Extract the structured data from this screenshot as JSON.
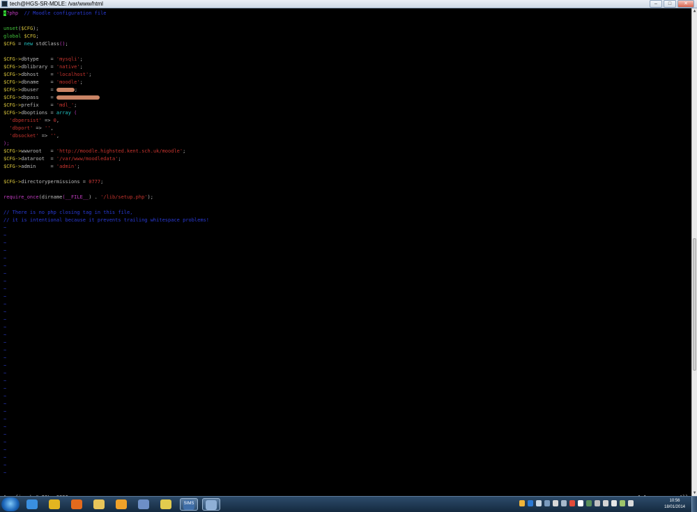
{
  "window": {
    "title": "tech@HGS-SR-MDLE: /var/www/html",
    "controls": {
      "minimize": "–",
      "maximize": "□",
      "close": "✕"
    }
  },
  "editor": {
    "lines": [
      {
        "tokens": [
          {
            "t": "<",
            "c": "tok-cursor"
          },
          {
            "t": "?php",
            "c": "tok-fn"
          },
          {
            "t": "  // Moodle configuration file",
            "c": "tok-cmt"
          }
        ]
      },
      {
        "tokens": []
      },
      {
        "tokens": [
          {
            "t": "unset",
            "c": "tok-green"
          },
          {
            "t": "(",
            "c": "tok-op"
          },
          {
            "t": "$CFG",
            "c": "tok-var"
          },
          {
            "t": ");",
            "c": "tok-op"
          }
        ]
      },
      {
        "tokens": [
          {
            "t": "global",
            "c": "tok-green"
          },
          {
            "t": " $CFG",
            "c": "tok-var"
          },
          {
            "t": ";",
            "c": "tok-op"
          }
        ]
      },
      {
        "tokens": [
          {
            "t": "$CFG",
            "c": "tok-var"
          },
          {
            "t": " = ",
            "c": "tok-op"
          },
          {
            "t": "new",
            "c": "tok-kw"
          },
          {
            "t": " stdClass",
            "c": "tok-op"
          },
          {
            "t": "()",
            "c": "tok-fn"
          },
          {
            "t": ";",
            "c": "tok-op"
          }
        ]
      },
      {
        "tokens": []
      },
      {
        "tokens": [
          {
            "t": "$CFG->",
            "c": "tok-var"
          },
          {
            "t": "dbtype    = ",
            "c": "tok-op"
          },
          {
            "t": "'mysqli'",
            "c": "tok-str"
          },
          {
            "t": ";",
            "c": "tok-op"
          }
        ]
      },
      {
        "tokens": [
          {
            "t": "$CFG->",
            "c": "tok-var"
          },
          {
            "t": "dblibrary = ",
            "c": "tok-op"
          },
          {
            "t": "'native'",
            "c": "tok-str"
          },
          {
            "t": ";",
            "c": "tok-op"
          }
        ]
      },
      {
        "tokens": [
          {
            "t": "$CFG->",
            "c": "tok-var"
          },
          {
            "t": "dbhost    = ",
            "c": "tok-op"
          },
          {
            "t": "'localhost'",
            "c": "tok-str"
          },
          {
            "t": ";",
            "c": "tok-op"
          }
        ]
      },
      {
        "tokens": [
          {
            "t": "$CFG->",
            "c": "tok-var"
          },
          {
            "t": "dbname    = ",
            "c": "tok-op"
          },
          {
            "t": "'moodle'",
            "c": "tok-str"
          },
          {
            "t": ";",
            "c": "tok-op"
          }
        ]
      },
      {
        "tokens": [
          {
            "t": "$CFG->",
            "c": "tok-var"
          },
          {
            "t": "dbuser    = ",
            "c": "tok-op"
          },
          {
            "t": "",
            "c": "redact",
            "w": 26
          },
          {
            "t": ";",
            "c": "tok-op"
          }
        ]
      },
      {
        "tokens": [
          {
            "t": "$CFG->",
            "c": "tok-var"
          },
          {
            "t": "dbpass    = ",
            "c": "tok-op"
          },
          {
            "t": "",
            "c": "redact",
            "w": 62
          }
        ]
      },
      {
        "tokens": [
          {
            "t": "$CFG->",
            "c": "tok-var"
          },
          {
            "t": "prefix    = ",
            "c": "tok-op"
          },
          {
            "t": "'mdl_'",
            "c": "tok-str"
          },
          {
            "t": ";",
            "c": "tok-op"
          }
        ]
      },
      {
        "tokens": [
          {
            "t": "$CFG->",
            "c": "tok-var"
          },
          {
            "t": "dboptions = ",
            "c": "tok-op"
          },
          {
            "t": "array",
            "c": "tok-kw"
          },
          {
            "t": " (",
            "c": "tok-fn"
          }
        ]
      },
      {
        "tokens": [
          {
            "t": "  ",
            "c": "tok-op"
          },
          {
            "t": "'dbpersist'",
            "c": "tok-str"
          },
          {
            "t": " => ",
            "c": "tok-op"
          },
          {
            "t": "0",
            "c": "tok-num"
          },
          {
            "t": ",",
            "c": "tok-op"
          }
        ]
      },
      {
        "tokens": [
          {
            "t": "  ",
            "c": "tok-op"
          },
          {
            "t": "'dbport'",
            "c": "tok-str"
          },
          {
            "t": " => ",
            "c": "tok-op"
          },
          {
            "t": "''",
            "c": "tok-str"
          },
          {
            "t": ",",
            "c": "tok-op"
          }
        ]
      },
      {
        "tokens": [
          {
            "t": "  ",
            "c": "tok-op"
          },
          {
            "t": "'dbsocket'",
            "c": "tok-str"
          },
          {
            "t": " => ",
            "c": "tok-op"
          },
          {
            "t": "''",
            "c": "tok-str"
          },
          {
            "t": ",",
            "c": "tok-op"
          }
        ]
      },
      {
        "tokens": [
          {
            "t": ");",
            "c": "tok-fn"
          }
        ]
      },
      {
        "tokens": [
          {
            "t": "$CFG->",
            "c": "tok-var"
          },
          {
            "t": "wwwroot   = ",
            "c": "tok-op"
          },
          {
            "t": "'http://moodle.highsted.kent.sch.uk/moodle'",
            "c": "tok-str"
          },
          {
            "t": ";",
            "c": "tok-op"
          }
        ]
      },
      {
        "tokens": [
          {
            "t": "$CFG->",
            "c": "tok-var"
          },
          {
            "t": "dataroot  = ",
            "c": "tok-op"
          },
          {
            "t": "'/var/www/moodledata'",
            "c": "tok-str"
          },
          {
            "t": ";",
            "c": "tok-op"
          }
        ]
      },
      {
        "tokens": [
          {
            "t": "$CFG->",
            "c": "tok-var"
          },
          {
            "t": "admin     = ",
            "c": "tok-op"
          },
          {
            "t": "'admin'",
            "c": "tok-str"
          },
          {
            "t": ";",
            "c": "tok-op"
          }
        ]
      },
      {
        "tokens": []
      },
      {
        "tokens": [
          {
            "t": "$CFG->",
            "c": "tok-var"
          },
          {
            "t": "directorypermissions = ",
            "c": "tok-op"
          },
          {
            "t": "0777",
            "c": "tok-num"
          },
          {
            "t": ";",
            "c": "tok-op"
          }
        ]
      },
      {
        "tokens": []
      },
      {
        "tokens": [
          {
            "t": "require_once",
            "c": "tok-fn"
          },
          {
            "t": "(",
            "c": "tok-op"
          },
          {
            "t": "dirname",
            "c": "tok-op"
          },
          {
            "t": "(",
            "c": "tok-fn"
          },
          {
            "t": "__FILE__",
            "c": "tok-fn"
          },
          {
            "t": ") . ",
            "c": "tok-op"
          },
          {
            "t": "'/lib/setup.php'",
            "c": "tok-str"
          },
          {
            "t": ");",
            "c": "tok-op"
          }
        ]
      },
      {
        "tokens": []
      },
      {
        "tokens": [
          {
            "t": "// There is no php closing tag in this file,",
            "c": "tok-cmt"
          }
        ]
      },
      {
        "tokens": [
          {
            "t": "// it is intentional because it prevents trailing whitespace problems!",
            "c": "tok-cmt"
          }
        ]
      }
    ],
    "tilde": "~",
    "tilde_count": 33,
    "status_left": "\"config.php\" 28L, 938C",
    "cursor_position": "1,1",
    "scroll_state": "All"
  },
  "taskbar": {
    "items": [
      {
        "name": "internet-explorer-icon",
        "color": "#3a8fe0",
        "active": false
      },
      {
        "name": "chrome-icon",
        "color": "#e3b520",
        "active": false
      },
      {
        "name": "firefox-icon",
        "color": "#e46a1d",
        "active": false
      },
      {
        "name": "file-explorer-icon",
        "color": "#e8c55a",
        "active": false
      },
      {
        "name": "outlook-icon",
        "color": "#f0a22a",
        "active": false
      },
      {
        "name": "network-tool-icon",
        "color": "#6d8fc7",
        "active": false
      },
      {
        "name": "notes-icon",
        "color": "#e2cc4e",
        "active": false
      },
      {
        "name": "sims-icon",
        "color": "#3f6ea8",
        "active": true,
        "label": "SIMS"
      },
      {
        "name": "putty-icon",
        "color": "#8fb0d6",
        "active": true
      }
    ],
    "clock_time": "10:56",
    "clock_date": "18/01/2014"
  }
}
